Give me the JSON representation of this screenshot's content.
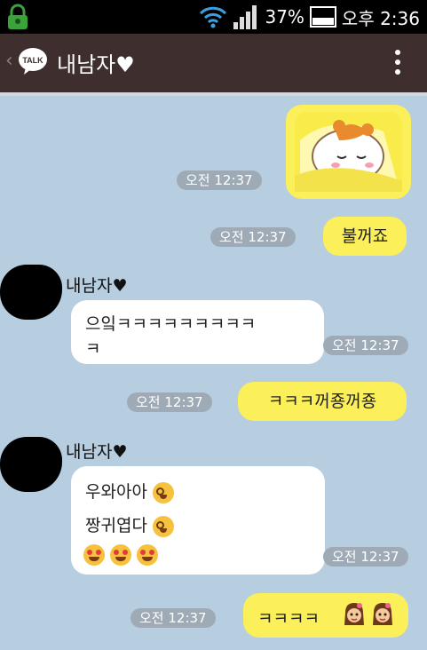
{
  "status_bar": {
    "battery_percent": "37%",
    "clock": "오후 2:36"
  },
  "header": {
    "room_title": "내남자♥",
    "talk_logo": "TALK",
    "back_label": "‹"
  },
  "messages": [
    {
      "side": "me",
      "type": "sticker",
      "time": "오전 12:37",
      "sticker": "sleeping-hamster"
    },
    {
      "side": "me",
      "type": "text",
      "time": "오전 12:37",
      "text": "불꺼죠"
    },
    {
      "side": "other",
      "sender": "내남자♥",
      "time": "오전 12:37",
      "line1": "으잌ㅋㅋㅋㅋㅋㅋㅋㅋㅋ",
      "line2": "ㅋ"
    },
    {
      "side": "me",
      "type": "text",
      "time": "오전 12:37",
      "text": "ㅋㅋㅋ꺼죵꺼죵"
    },
    {
      "side": "other",
      "sender": "내남자♥",
      "time": "오전 12:37",
      "line1": "우와아아",
      "line2": "짱귀엽다",
      "emojis": [
        "dizzy-face",
        "heart-eyes"
      ]
    },
    {
      "side": "me",
      "type": "text",
      "time": "오전 12:37",
      "text": "ㅋㅋㅋㅋ",
      "emojis": [
        "girl-face"
      ]
    }
  ],
  "colors": {
    "my_bubble": "#fcf05a",
    "other_bubble": "#ffffff",
    "background": "#b7cde0",
    "header": "#3e2f2e",
    "time_badge": "#9eabb7"
  }
}
